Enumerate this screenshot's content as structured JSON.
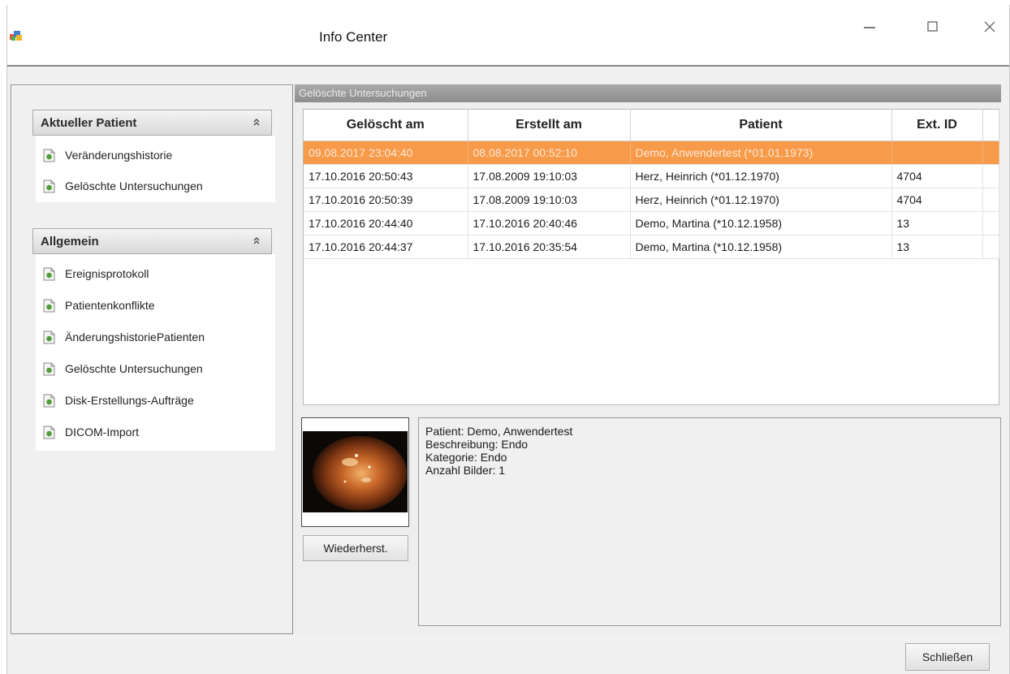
{
  "window": {
    "title": "Info Center",
    "controls": {
      "minimize_icon": "minimize-icon",
      "maximize_icon": "maximize-icon",
      "close_icon": "close-icon"
    }
  },
  "sidebar": {
    "groups": [
      {
        "header": "Aktueller Patient",
        "items": [
          {
            "label": "Veränderungshistorie",
            "icon": "document-icon"
          },
          {
            "label": "Gelöschte Untersuchungen",
            "icon": "document-icon"
          }
        ]
      },
      {
        "header": "Allgemein",
        "items": [
          {
            "label": "Ereignisprotokoll",
            "icon": "document-icon"
          },
          {
            "label": "Patientenkonflikte",
            "icon": "document-icon"
          },
          {
            "label": "ÄnderungshistoriePatienten",
            "icon": "document-icon"
          },
          {
            "label": "Gelöschte Untersuchungen",
            "icon": "document-icon"
          },
          {
            "label": "Disk-Erstellungs-Aufträge",
            "icon": "document-icon"
          },
          {
            "label": "DICOM-Import",
            "icon": "document-icon"
          }
        ]
      }
    ]
  },
  "main": {
    "panel_title": "Gelöschte Untersuchungen",
    "table": {
      "columns": [
        "Gelöscht am",
        "Erstellt am",
        "Patient",
        "Ext. ID"
      ],
      "rows": [
        [
          "09.08.2017 23:04:40",
          "08.08.2017 00:52:10",
          "Demo, Anwendertest (*01.01.1973)",
          ""
        ],
        [
          "17.10.2016 20:50:43",
          "17.08.2009 19:10:03",
          "Herz, Heinrich (*01.12.1970)",
          "4704"
        ],
        [
          "17.10.2016 20:50:39",
          "17.08.2009 19:10:03",
          "Herz, Heinrich (*01.12.1970)",
          "4704"
        ],
        [
          "17.10.2016 20:44:40",
          "17.10.2016 20:40:46",
          "Demo, Martina (*10.12.1958)",
          "13"
        ],
        [
          "17.10.2016 20:44:37",
          "17.10.2016 20:35:54",
          "Demo, Martina (*10.12.1958)",
          "13"
        ]
      ],
      "selected_row": 0
    },
    "details": {
      "patient": "Patient: Demo, Anwendertest",
      "description": "Beschreibung: Endo",
      "category": "Kategorie: Endo",
      "image_count": "Anzahl Bilder: 1"
    },
    "restore_button": "Wiederherst."
  },
  "footer": {
    "close_button": "Schließen"
  },
  "colors": {
    "selection": "#f79a4a",
    "panel_header": "#9b9b9b",
    "window_bg": "#f0f0f0"
  }
}
